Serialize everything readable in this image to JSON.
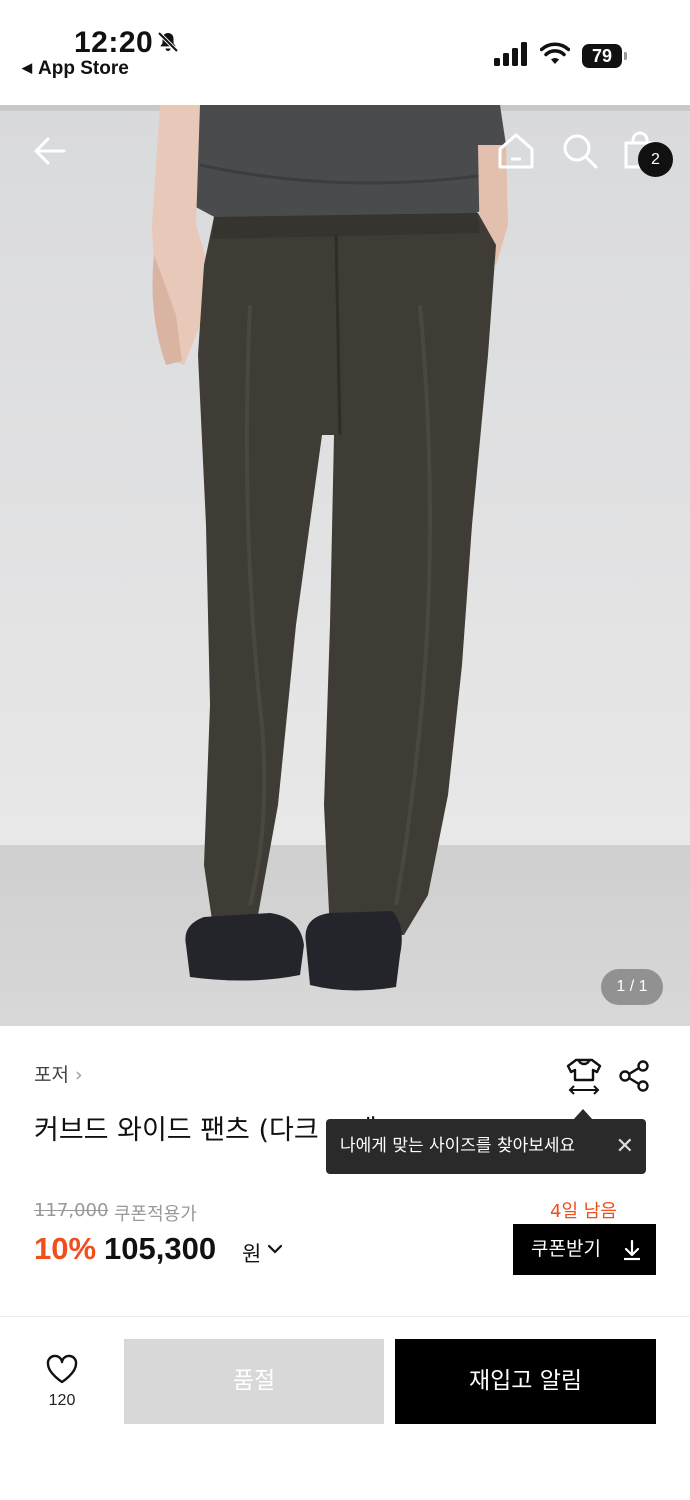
{
  "status_bar": {
    "time": "12:20",
    "back_app": "App Store",
    "battery": "79",
    "icons": [
      "bell-slash-icon",
      "signal-icon",
      "wifi-icon",
      "battery-icon"
    ]
  },
  "top_nav": {
    "icons": [
      "back-arrow-icon",
      "home-icon",
      "search-icon",
      "cart-icon"
    ],
    "cart_count": "2"
  },
  "gallery": {
    "page_indicator": "1 / 1"
  },
  "product": {
    "brand": "포저",
    "brand_chevron": "›",
    "title": "커브드 와이드 팬츠 (다크 그레",
    "tooltip": "나에게 맞는 사이즈를 찾아보세요",
    "tooltip_close": "✕",
    "original_price": "117,000",
    "coupon_price_label": "쿠폰적용가",
    "discount": "10%",
    "price": "105,300",
    "currency": "원",
    "days_left": "4일 남음",
    "coupon_button": "쿠폰받기"
  },
  "bottom_bar": {
    "like_count": "120",
    "soldout_label": "품절",
    "restock_label": "재입고 알림"
  },
  "colors": {
    "accent": "#f04e1c",
    "dark": "#000000",
    "disabled": "#d8d8d8"
  }
}
